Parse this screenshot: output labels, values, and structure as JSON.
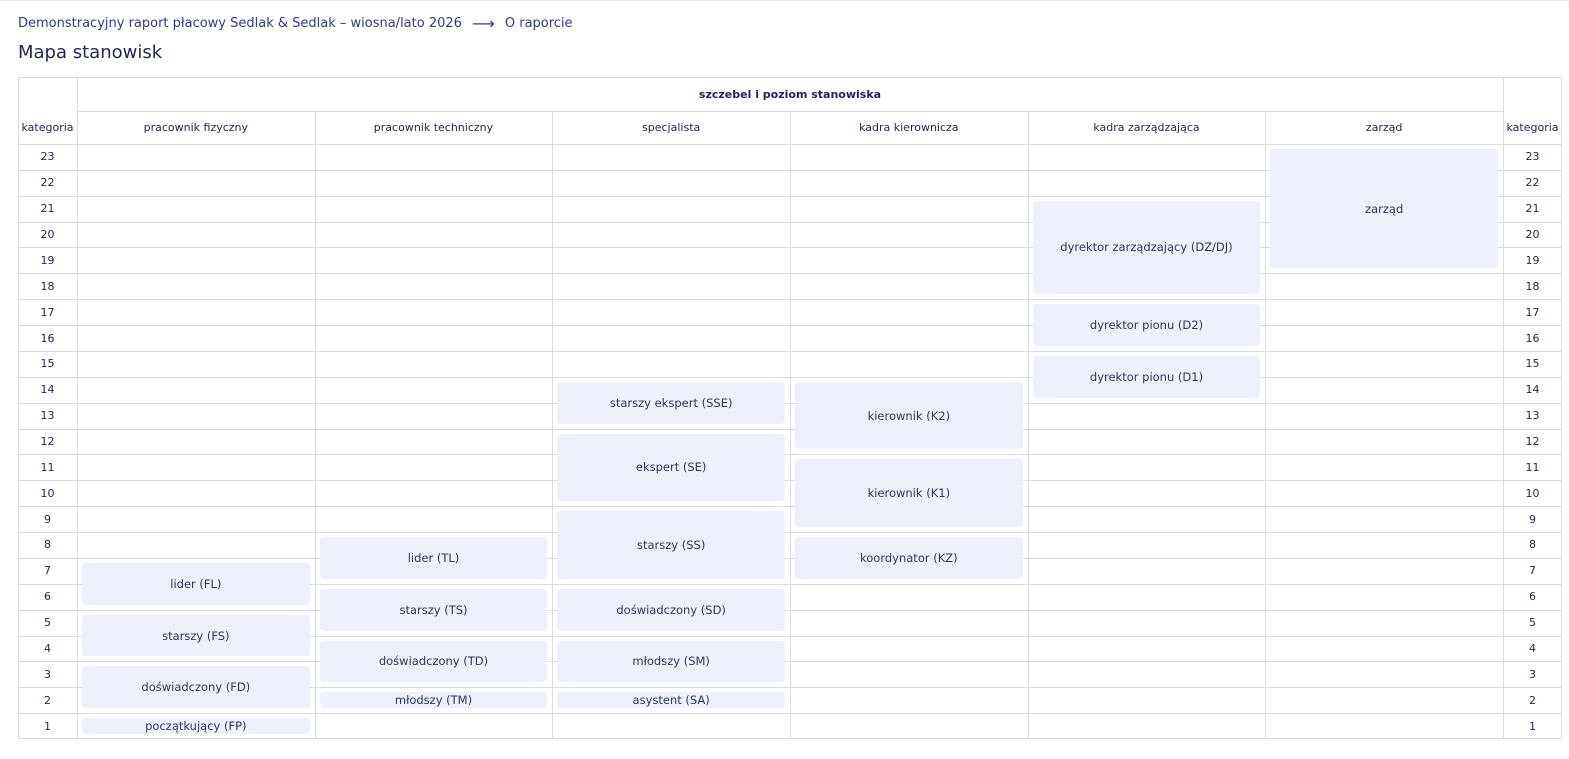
{
  "breadcrumb": {
    "report": "Demonstracyjny raport płacowy Sedlak & Sedlak – wiosna/lato 2026",
    "arrow": "⟶",
    "current": "O raporcie"
  },
  "page_title": "Mapa stanowisk",
  "table": {
    "group_header": "szczebel i poziom stanowiska",
    "category_header_left": "kategoria",
    "category_header_right": "kategoria",
    "columns": [
      "pracownik fizyczny",
      "pracownik techniczny",
      "specjalista",
      "kadra kierownicza",
      "kadra zarządzająca",
      "zarząd"
    ],
    "categories": [
      23,
      22,
      21,
      20,
      19,
      18,
      17,
      16,
      15,
      14,
      13,
      12,
      11,
      10,
      9,
      8,
      7,
      6,
      5,
      4,
      3,
      2,
      1
    ],
    "positions": [
      {
        "label": "lider (FL)",
        "column": 0,
        "from": 6,
        "to": 7
      },
      {
        "label": "starszy (FS)",
        "column": 0,
        "from": 4,
        "to": 5
      },
      {
        "label": "doświadczony (FD)",
        "column": 0,
        "from": 2,
        "to": 3
      },
      {
        "label": "początkujący (FP)",
        "column": 0,
        "from": 1,
        "to": 1
      },
      {
        "label": "lider (TL)",
        "column": 1,
        "from": 7,
        "to": 8
      },
      {
        "label": "starszy (TS)",
        "column": 1,
        "from": 5,
        "to": 6
      },
      {
        "label": "doświadczony (TD)",
        "column": 1,
        "from": 3,
        "to": 4
      },
      {
        "label": "młodszy (TM)",
        "column": 1,
        "from": 2,
        "to": 2
      },
      {
        "label": "starszy ekspert (SSE)",
        "column": 2,
        "from": 13,
        "to": 14
      },
      {
        "label": "ekspert (SE)",
        "column": 2,
        "from": 10,
        "to": 12
      },
      {
        "label": "starszy (SS)",
        "column": 2,
        "from": 7,
        "to": 9
      },
      {
        "label": "doświadczony (SD)",
        "column": 2,
        "from": 5,
        "to": 6
      },
      {
        "label": "młodszy (SM)",
        "column": 2,
        "from": 3,
        "to": 4
      },
      {
        "label": "asystent (SA)",
        "column": 2,
        "from": 2,
        "to": 2
      },
      {
        "label": "kierownik (K2)",
        "column": 3,
        "from": 12,
        "to": 14
      },
      {
        "label": "kierownik (K1)",
        "column": 3,
        "from": 9,
        "to": 11
      },
      {
        "label": "koordynator (KZ)",
        "column": 3,
        "from": 7,
        "to": 8
      },
      {
        "label": "dyrektor zarządzający (DZ/DJ)",
        "column": 4,
        "from": 18,
        "to": 21
      },
      {
        "label": "dyrektor pionu (D2)",
        "column": 4,
        "from": 16,
        "to": 17
      },
      {
        "label": "dyrektor pionu (D1)",
        "column": 4,
        "from": 14,
        "to": 15
      },
      {
        "label": "zarząd",
        "column": 5,
        "from": 19,
        "to": 23
      }
    ]
  }
}
